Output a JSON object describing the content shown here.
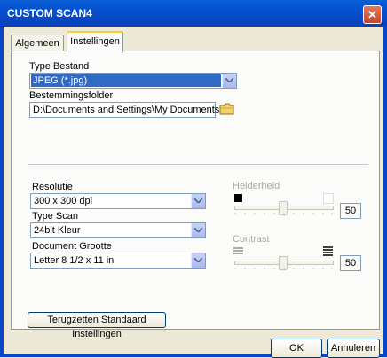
{
  "window": {
    "title": "CUSTOM SCAN4",
    "close_glyph": "✕"
  },
  "tabs": [
    {
      "label": "Algemeen",
      "active": false
    },
    {
      "label": "Instellingen",
      "active": true
    }
  ],
  "file_type": {
    "label": "Type Bestand",
    "value": "JPEG (*.jpg)"
  },
  "destination": {
    "label": "Bestemmingsfolder",
    "value": "D:\\Documents and Settings\\My Documents",
    "browse_icon": "folder-icon"
  },
  "resolution": {
    "label": "Resolutie",
    "value": "300 x 300 dpi"
  },
  "scan_type": {
    "label": "Type Scan",
    "value": "24bit Kleur"
  },
  "document_size": {
    "label": "Document Grootte",
    "value": "Letter 8 1/2 x 11 in"
  },
  "brightness": {
    "label": "Helderheid",
    "value": "50",
    "level": 0.5,
    "enabled": false
  },
  "contrast": {
    "label": "Contrast",
    "value": "50",
    "level": 0.5,
    "enabled": false
  },
  "buttons": {
    "reset": "Terugzetten Standaard Instellingen",
    "ok": "OK",
    "cancel": "Annuleren"
  },
  "colors": {
    "titlebar": "#0a5fd6",
    "selection": "#316ac5",
    "dialog_bg": "#ece9d8",
    "tab_highlight": "#ffc83c"
  }
}
